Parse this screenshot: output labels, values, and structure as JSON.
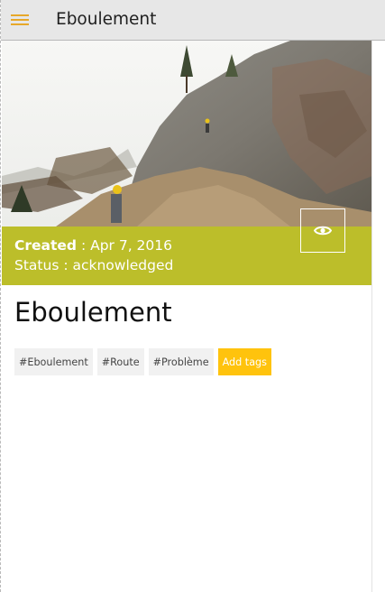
{
  "header": {
    "title": "Eboulement",
    "menu_icon": "hamburger-menu-icon"
  },
  "report": {
    "created_label": "Created",
    "created_value": " : Apr 7, 2016",
    "status_text": "Status : acknowledged",
    "title": "Eboulement",
    "view_icon": "eye-icon"
  },
  "tags": [
    "#Eboulement",
    "#Route",
    "#Problème"
  ],
  "add_tags_label": "Add tags",
  "colors": {
    "accent": "#e7a82a",
    "info_band": "#bcbe2a",
    "add_tags": "#ffc30d"
  }
}
